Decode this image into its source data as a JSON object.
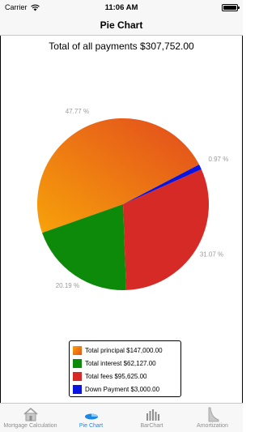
{
  "status_bar": {
    "carrier": "Carrier",
    "time": "11:06 AM"
  },
  "nav": {
    "title": "Pie Chart"
  },
  "chart_data": {
    "type": "pie",
    "title": "Total of all payments $307,752.00",
    "slices": [
      {
        "name": "Total principal $147,000.00",
        "value": 147000.0,
        "percent_label": "47.77 %",
        "color": "#f28a0c"
      },
      {
        "name": "Total interest $62,127.00",
        "value": 62127.0,
        "percent_label": "20.19 %",
        "color": "#0e8a0a"
      },
      {
        "name": "Total fees $95,625.00",
        "value": 95625.0,
        "percent_label": "31.07 %",
        "color": "#d62a27"
      },
      {
        "name": "Down Payment $3,000.00",
        "value": 3000.0,
        "percent_label": "0.97 %",
        "color": "#0a14e0"
      }
    ],
    "legend": "bottom-center"
  },
  "tabs": [
    {
      "label": "Mortgage Calculation",
      "icon": "house-icon",
      "active": false
    },
    {
      "label": "Pie Chart",
      "icon": "pie-chart-icon",
      "active": true
    },
    {
      "label": "BarChart",
      "icon": "bar-chart-icon",
      "active": false
    },
    {
      "label": "Amortization",
      "icon": "amortization-icon",
      "active": false
    }
  ]
}
